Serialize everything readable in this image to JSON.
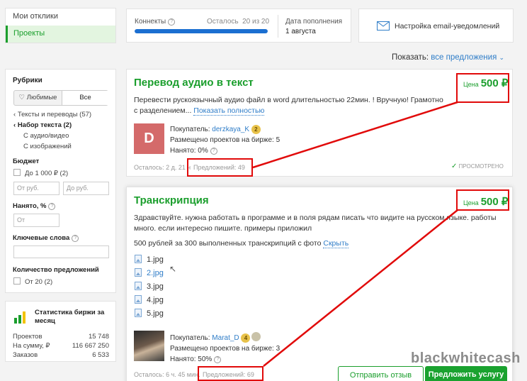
{
  "nav": {
    "responses": "Мои отклики",
    "projects": "Проекты"
  },
  "connects": {
    "label": "Коннекты",
    "remaining": "Осталось  20 из 20",
    "progress": 1.0,
    "refill_label": "Дата пополнения",
    "refill_date": "1 августа"
  },
  "email": {
    "label": "Настройка email-уведомлений"
  },
  "show": {
    "label": "Показать:",
    "value": "все предложения"
  },
  "filters": {
    "rubrics_title": "Рубрики",
    "tab_favorites": "Любимые",
    "tab_all": "Все",
    "cat_parent": "Тексты и переводы (57)",
    "cat_current": "Набор текста (2)",
    "cat_sub1": "С аудио/видео",
    "cat_sub2": "С изображений",
    "budget_title": "Бюджет",
    "budget_option": "До 1 000 ₽ (2)",
    "from_placeholder": "От руб.",
    "to_placeholder": "До руб.",
    "hired_title": "Нанято, %",
    "hired_placeholder": "От",
    "keywords_title": "Ключевые слова",
    "offers_title": "Количество предложений",
    "offers_option": "От 20 (2)"
  },
  "stats": {
    "title": "Статистика биржи за месяц",
    "rows": [
      {
        "label": "Проектов",
        "value": "15 748"
      },
      {
        "label": "На сумму, ₽",
        "value": "116 667 250"
      },
      {
        "label": "Заказов",
        "value": "6 533"
      }
    ]
  },
  "project1": {
    "title": "Перевод аудио в текст",
    "price_label": "Цена",
    "price": "500 ₽",
    "description": "Перевести рускоязычный аудио файл в word длительностью 22мин. ! Вручную! Грамотно с разделением...",
    "show_more": "Показать полностью",
    "avatar_letter": "D",
    "buyer_label": "Покупатель:",
    "buyer_name": "derzkaya_K",
    "buyer_badge": "2",
    "placed": "Размещено проектов на бирже: 5",
    "hired": "Нанято: 0%",
    "time_left": "Осталось: 2 д. 21 ч",
    "offers": "Предложений: 49",
    "viewed": "ПРОСМОТРЕНО"
  },
  "project2": {
    "title": "Транскрипция",
    "price_label": "Цена",
    "price": "500 ₽",
    "description": "Здравствуйте. нужна работать в программе и в поля рядам писать что видите на русском языке. работы много. если интересно пишите. примеры приложил",
    "note": "500 рублей за 300 выполненных транскрипций с фото",
    "hide": "Скрыть",
    "files": [
      "1.jpg",
      "2.jpg",
      "3.jpg",
      "4.jpg",
      "5.jpg"
    ],
    "buyer_label": "Покупатель:",
    "buyer_name": "Marat_D",
    "buyer_badge": "4",
    "placed": "Размещено проектов на бирже: 3",
    "hired": "Нанято: 50%",
    "time_left": "Осталось: 6 ч. 45 мин.",
    "offers": "Предложений: 69",
    "review_btn": "Отправить отзыв",
    "offer_btn": "Предложить услугу"
  },
  "watermark": "blackwhitecash",
  "colors": {
    "accent_green": "#1a9e2c",
    "link_blue": "#2f7dc8",
    "highlight_red": "#e10a0a",
    "progress_blue": "#1b6fd1",
    "avatar_red": "#d46a6a"
  }
}
